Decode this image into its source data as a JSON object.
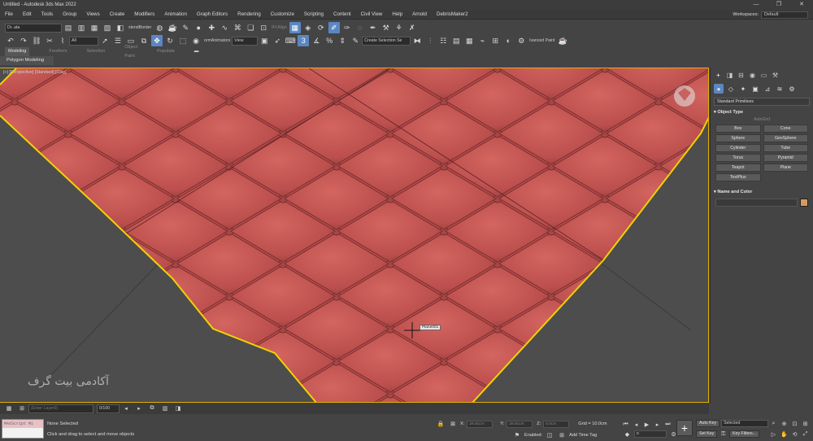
{
  "window": {
    "title": "Untitled - Autodesk 3ds Max 2022",
    "minimize_glyph": "—",
    "maximize_glyph": "❐",
    "close_glyph": "✕"
  },
  "menu": [
    "File",
    "Edit",
    "Tools",
    "Group",
    "Views",
    "Create",
    "Modifiers",
    "Animation",
    "Graph Editors",
    "Rendering",
    "Customize",
    "Scripting",
    "Content",
    "Civil View",
    "Help",
    "Arnold",
    "DebrisMaker2"
  ],
  "workspace": {
    "label": "Workspaces:",
    "value": "Default"
  },
  "toolbar1": {
    "layer_select": "Dr..ata",
    "xtend_border": "xtendBorder",
    "lf_align": "lFt Align"
  },
  "toolbar2": {
    "filter_select": "All",
    "anim_label": "ormAnimators",
    "view_select": "View",
    "selection_set": "Create Selection Se",
    "advanced_paint": "lvanced Paint"
  },
  "ribbon": {
    "tabs": [
      "Modeling",
      "Freeform",
      "Selection",
      "Object Paint",
      "Populate"
    ],
    "active_panel": "Polygon Modeling"
  },
  "viewport": {
    "label": "[+] [Perspective] [Standard] [Clay]",
    "cursor_tooltip": "Plane001",
    "watermark": "آکادمی بیت گرف"
  },
  "command_panel": {
    "category": "Standard Primitives",
    "object_type_header": "Object Type",
    "autogrid": "AutoGrid",
    "objects": [
      "Box",
      "Cone",
      "Sphere",
      "GeoSphere",
      "Cylinder",
      "Tube",
      "Torus",
      "Pyramid",
      "Teapot",
      "Plane",
      "TextPlus"
    ],
    "name_color_header": "Name and Color",
    "object_color": "#d79a5c"
  },
  "timeline": {
    "layer_label": "(Enter Layer0)",
    "frame_value": "0/100"
  },
  "status": {
    "maxscript_placeholder": "MAXScript Mi",
    "selection_status": "None Selected",
    "prompt": "Click and drag to select and move objects",
    "x_label": "X:",
    "x_value": "26.91cm",
    "y_label": "Y:",
    "y_value": "26.91cm",
    "z_label": "Z:",
    "z_value": "0.0cm",
    "grid": "Grid = 10.0cm",
    "enabled_label": "Enabled:",
    "add_time_tag": "Add Time Tag",
    "auto_key": "Auto Key",
    "key_mode": "Selected",
    "set_key": "Set Key",
    "key_filters": "Key Filters...",
    "frame": "0"
  }
}
